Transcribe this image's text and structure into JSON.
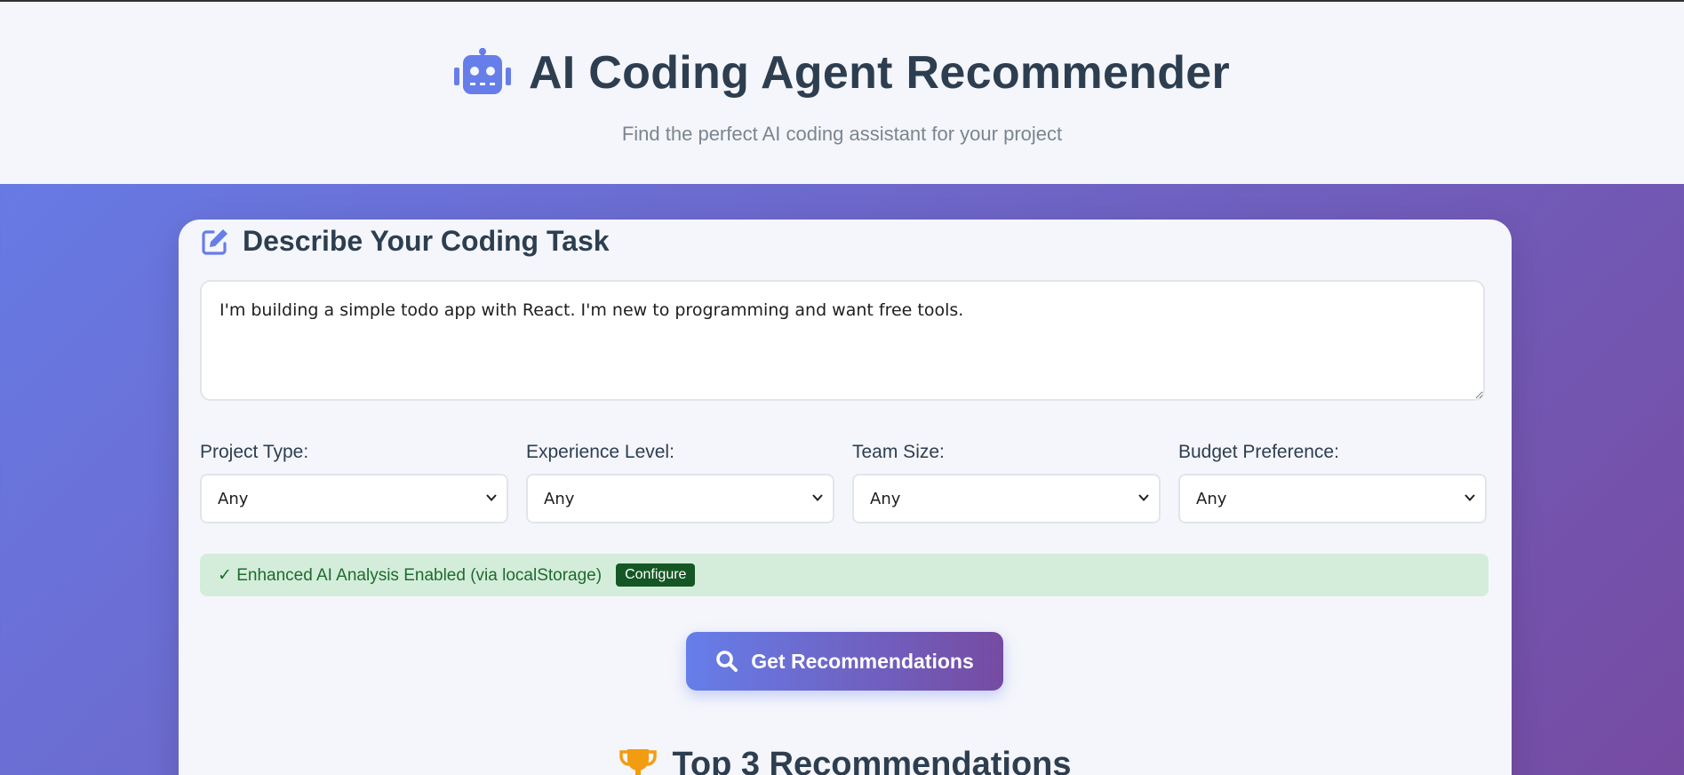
{
  "header": {
    "title": "AI Coding Agent Recommender",
    "subtitle": "Find the perfect AI coding assistant for your project",
    "icon": "robot-icon"
  },
  "task": {
    "section_title": "Describe Your Coding Task",
    "section_icon": "edit-icon",
    "description_value": "I'm building a simple todo app with React. I'm new to programming and want free tools."
  },
  "filters": [
    {
      "label": "Project Type:",
      "selected": "Any"
    },
    {
      "label": "Experience Level:",
      "selected": "Any"
    },
    {
      "label": "Team Size:",
      "selected": "Any"
    },
    {
      "label": "Budget Preference:",
      "selected": "Any"
    }
  ],
  "status": {
    "text": "✓ Enhanced AI Analysis Enabled (via localStorage)",
    "configure_label": "Configure"
  },
  "actions": {
    "recommend_label": "Get Recommendations",
    "recommend_icon": "search-icon"
  },
  "results": {
    "title": "Top 3 Recommendations",
    "icon": "trophy-icon"
  },
  "colors": {
    "accent": "#667eea",
    "accent_dark": "#764ba2",
    "heading": "#2d3e50",
    "success_bg": "#d4edda",
    "success_text": "#1e6b2e",
    "configure_bg": "#155724",
    "trophy": "#f39c12"
  }
}
